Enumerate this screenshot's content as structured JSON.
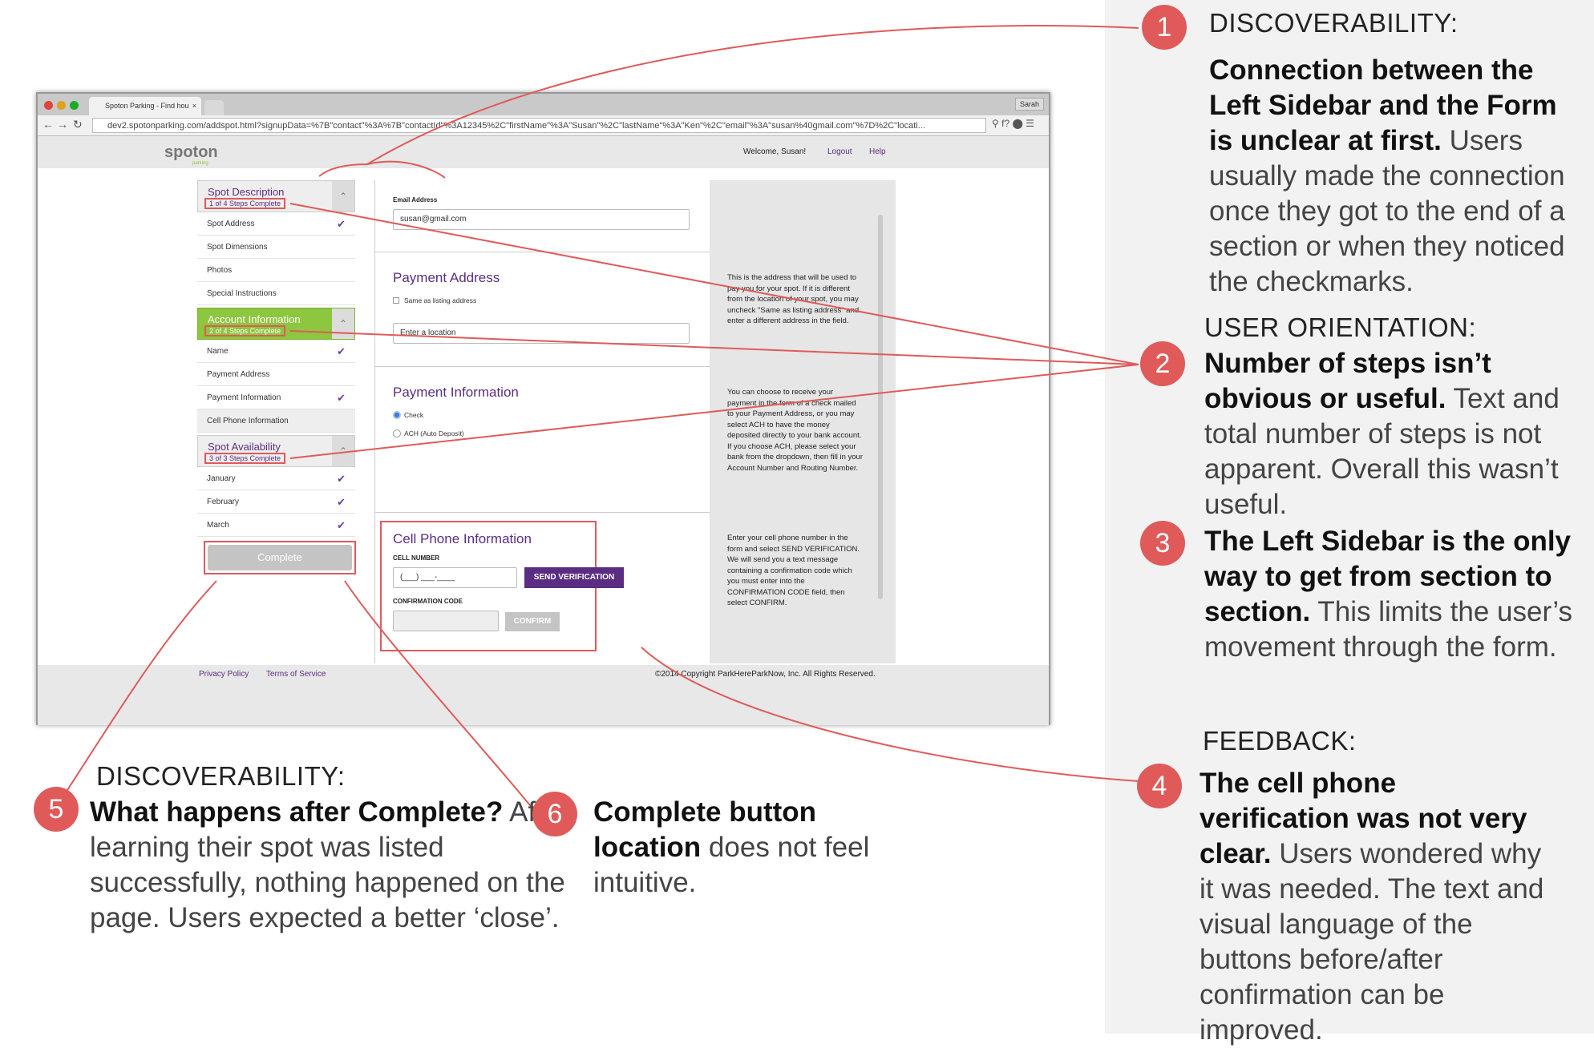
{
  "annotations": {
    "a1": {
      "number": "1",
      "heading": "DISCOVERABILITY:",
      "bold": "Connection between the Left Sidebar and the Form is unclear at first.",
      "text": "Users usually made the connection once they got to the end of a section or when they noticed the checkmarks."
    },
    "a2": {
      "number": "2",
      "heading": "USER ORIENTATION:",
      "bold": "Number of steps isn’t obvious or useful.",
      "text": "Text and total number of steps is not apparent. Overall this wasn’t useful."
    },
    "a3": {
      "number": "3",
      "bold": "The Left Sidebar is the only way to get from section to section.",
      "text": "This limits the user’s movement through the form."
    },
    "a4": {
      "number": "4",
      "heading": "FEEDBACK:",
      "bold": "The cell phone verification was not very clear.",
      "text": "Users wondered why it was needed. The text and visual language of the buttons before/after confirmation can be improved."
    },
    "a5": {
      "number": "5",
      "heading": "DISCOVERABILITY:",
      "bold": "What happens after Complete?",
      "text": "After learning their spot was listed successfully, nothing happened on the page. Users expected a better ‘close’."
    },
    "a6": {
      "number": "6",
      "bold": "Complete button location",
      "text": "does not feel intuitive."
    }
  },
  "browser": {
    "tab_title": "Spoton Parking - Find hou",
    "tab_close": "×",
    "user": "Sarah",
    "url": "dev2.spotonparking.com/addspot.html?signupData=%7B\"contact\"%3A%7B\"contactId\"%3A12345%2C\"firstName\"%3A\"Susan\"%2C\"lastName\"%3A\"Ken\"%2C\"email\"%3A\"susan%40gmail.com\"%7D%2C\"locati..."
  },
  "site": {
    "logo": "spoton",
    "logo_sub": "parking",
    "welcome": "Welcome, Susan!",
    "logout": "Logout",
    "help": "Help",
    "privacy": "Privacy Policy",
    "terms": "Terms of Service",
    "copyright": "©2014 Copyright ParkHereParkNow, Inc. All Rights Reserved."
  },
  "sidebar": {
    "sections": [
      {
        "title": "Spot Description",
        "steps": "1 of 4 Steps Complete",
        "items": [
          {
            "label": "Spot Address",
            "checked": true
          },
          {
            "label": "Spot Dimensions",
            "checked": false
          },
          {
            "label": "Photos",
            "checked": false
          },
          {
            "label": "Special Instructions",
            "checked": false
          }
        ]
      },
      {
        "title": "Account Information",
        "steps": "2 of 4 Steps Complete",
        "items": [
          {
            "label": "Name",
            "checked": true
          },
          {
            "label": "Payment Address",
            "checked": false
          },
          {
            "label": "Payment Information",
            "checked": true
          },
          {
            "label": "Cell Phone Information",
            "checked": false
          }
        ]
      },
      {
        "title": "Spot Availability",
        "steps": "3 of 3 Steps Complete",
        "items": [
          {
            "label": "January",
            "checked": true
          },
          {
            "label": "February",
            "checked": true
          },
          {
            "label": "March",
            "checked": true
          }
        ]
      }
    ],
    "complete_button": "Complete",
    "check_glyph": "✔"
  },
  "form": {
    "email_label": "Email Address",
    "email_value": "susan@gmail.com",
    "payment_address": {
      "title": "Payment Address",
      "same_as": "Same as listing address",
      "location_placeholder": "Enter a location",
      "help": "This is the address that will be used to pay you for your spot. If it is different from the location of your spot, you may uncheck \"Same as listing address\" and enter a different address in the field."
    },
    "payment_info": {
      "title": "Payment Information",
      "check": "Check",
      "ach": "ACH (Auto Deposit)",
      "help": "You can choose to receive your payment in the form of a check mailed to your Payment Address, or you may select ACH to have the money deposited directly to your bank account. If you choose ACH, please select your bank from the dropdown, then fill in your Account Number and Routing Number."
    },
    "cell_phone": {
      "title": "Cell Phone Information",
      "cell_label": "CELL NUMBER",
      "cell_placeholder": "(___) ___-____",
      "send_button": "SEND VERIFICATION",
      "code_label": "CONFIRMATION CODE",
      "confirm_button": "CONFIRM",
      "help": "Enter your cell phone number in the form and select SEND VERIFICATION. We will send you a text message containing a confirmation code which you must enter into the CONFIRMATION CODE field, then select CONFIRM."
    }
  },
  "colors": {
    "accent": "#5b2d82",
    "annotation": "#e05a5a",
    "green": "#8dc63f"
  }
}
